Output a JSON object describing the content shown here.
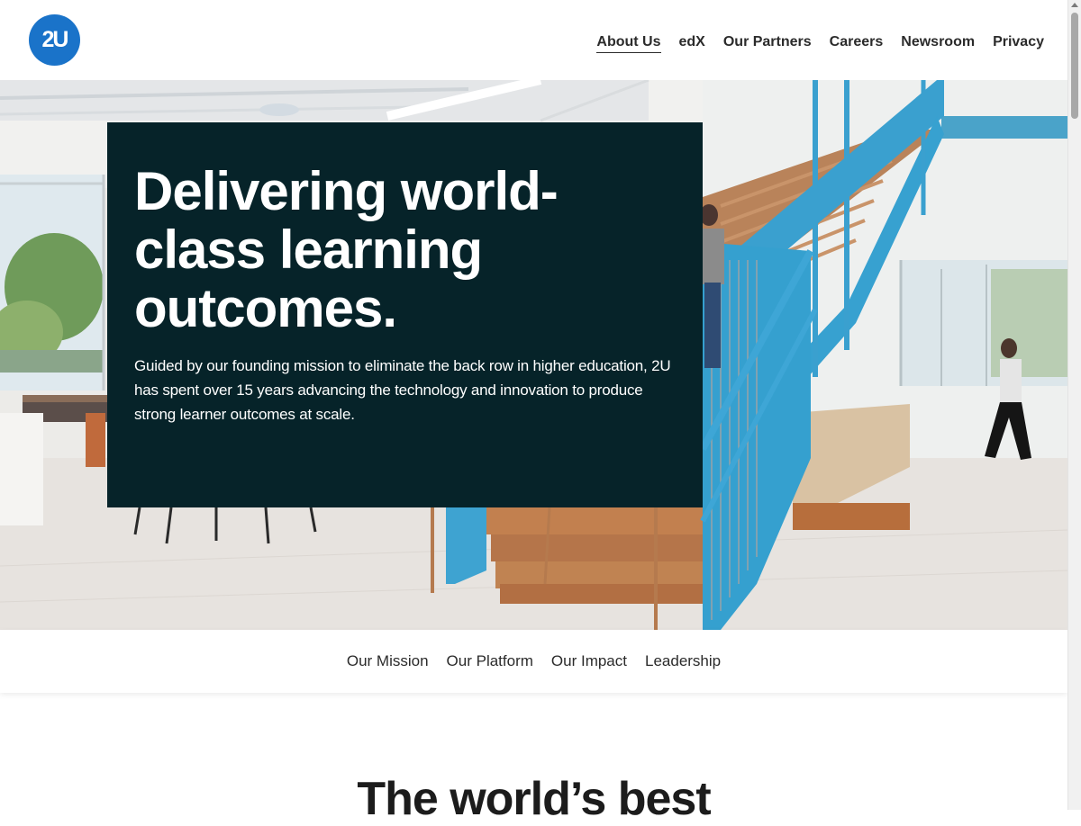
{
  "brand": {
    "logo_text": "2U",
    "accent": "#1a73c9",
    "hero_card_bg": "#062329"
  },
  "nav": {
    "items": [
      "About Us",
      "edX",
      "Our Partners",
      "Careers",
      "Newsroom",
      "Privacy"
    ],
    "active": "About Us"
  },
  "hero": {
    "title": "Delivering world-class learning outcomes.",
    "body": "Guided by our founding mission to eliminate the back row in higher education, 2U has spent over 15 years advancing the technology and innovation to produce strong learner outcomes at scale."
  },
  "subnav": {
    "items": [
      "Our Mission",
      "Our Platform",
      "Our Impact",
      "Leadership"
    ]
  },
  "section": {
    "heading": "The world’s best"
  },
  "icons": {
    "logo": "2u-logo-icon",
    "scrollbar_up": "chevron-up-icon"
  }
}
